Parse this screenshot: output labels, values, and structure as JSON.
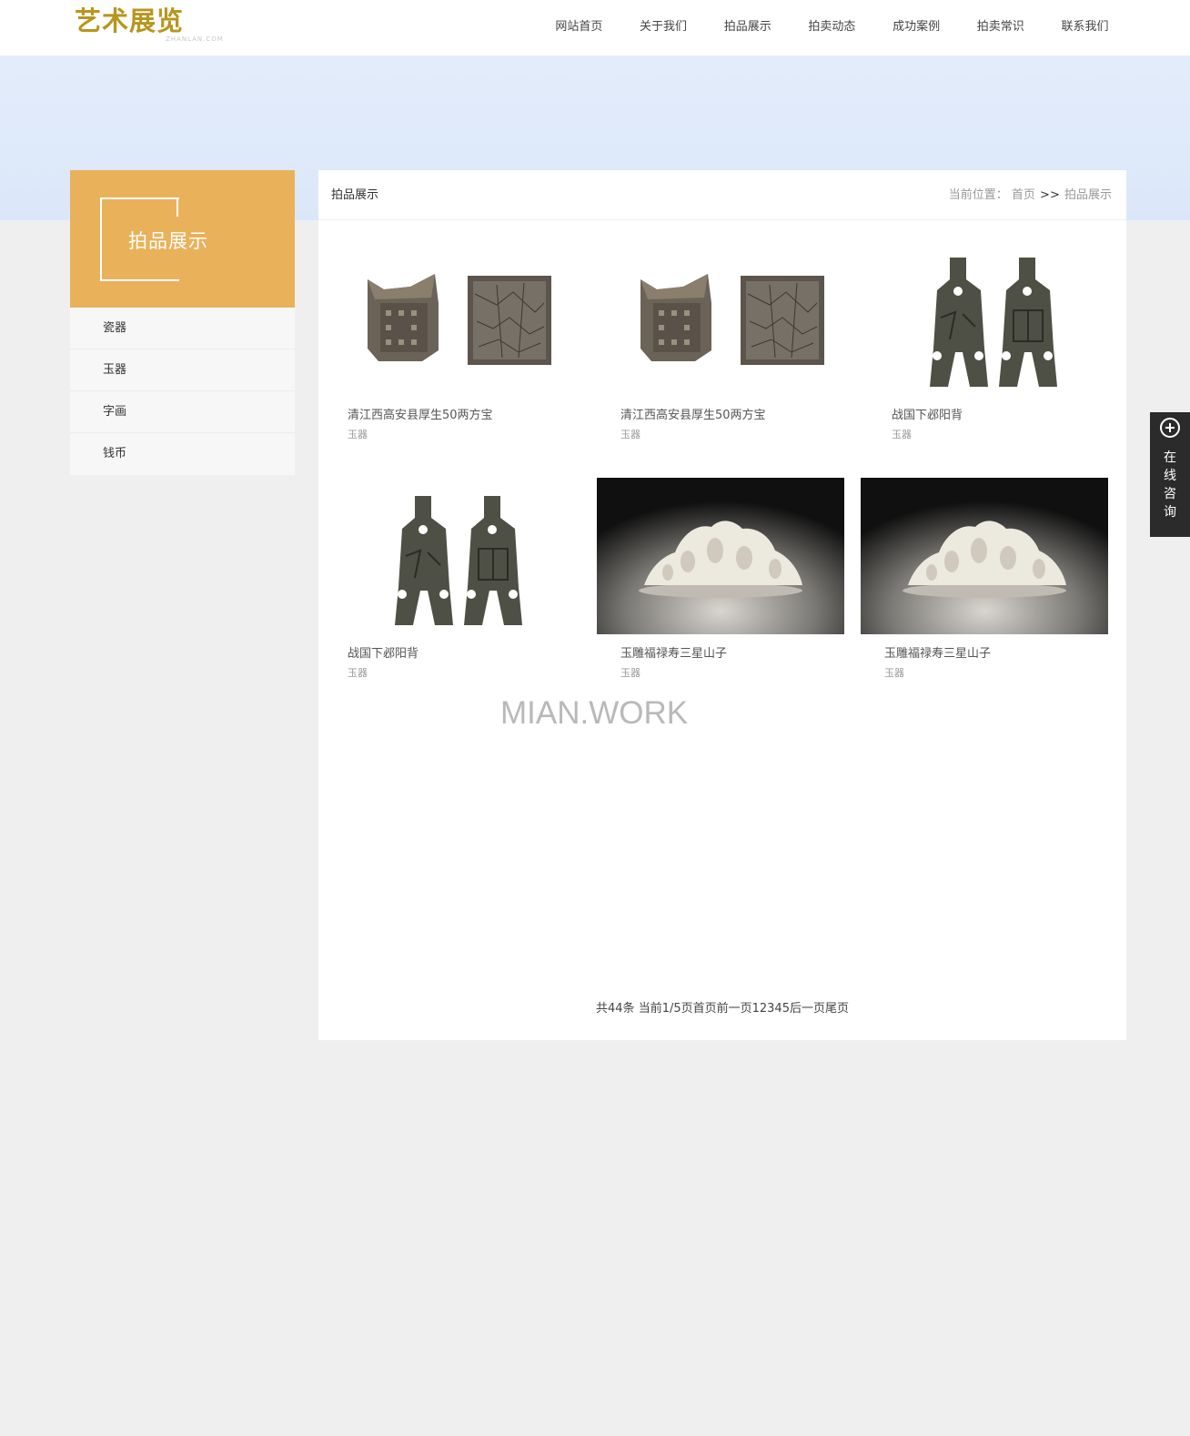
{
  "header": {
    "logo_text": "艺术展览",
    "logo_sub": "ZHANLAN.COM",
    "nav": [
      "网站首页",
      "关于我们",
      "拍品展示",
      "拍卖动态",
      "成功案例",
      "拍卖常识",
      "联系我们"
    ]
  },
  "sidebar": {
    "title": "拍品展示",
    "items": [
      "瓷器",
      "玉器",
      "字画",
      "钱币"
    ]
  },
  "main": {
    "title": "拍品展示",
    "breadcrumb": {
      "label": "当前位置：",
      "home": "首页",
      "sep": ">>",
      "current": "拍品展示"
    },
    "products": [
      {
        "name": "清江西高安县厚生50两方宝",
        "category": "玉器",
        "image": "silver-ingot"
      },
      {
        "name": "清江西高安县厚生50两方宝",
        "category": "玉器",
        "image": "silver-ingot"
      },
      {
        "name": "战国下邲阳背",
        "category": "玉器",
        "image": "spade-coin"
      },
      {
        "name": "战国下邲阳背",
        "category": "玉器",
        "image": "spade-coin"
      },
      {
        "name": "玉雕福禄寿三星山子",
        "category": "玉器",
        "image": "jade-carving"
      },
      {
        "name": "玉雕福禄寿三星山子",
        "category": "玉器",
        "image": "jade-carving"
      }
    ],
    "pagination": "共44条 当前1/5页首页前一页12345后一页尾页"
  },
  "watermark": "MIAN.WORK",
  "consult": {
    "label": "在线咨询",
    "chars": [
      "在",
      "线",
      "咨",
      "询"
    ]
  },
  "colors": {
    "accent": "#e9b25a",
    "logo": "#b8961e",
    "banner": "#dde8f9",
    "consult_bg": "#2b2b2b"
  }
}
